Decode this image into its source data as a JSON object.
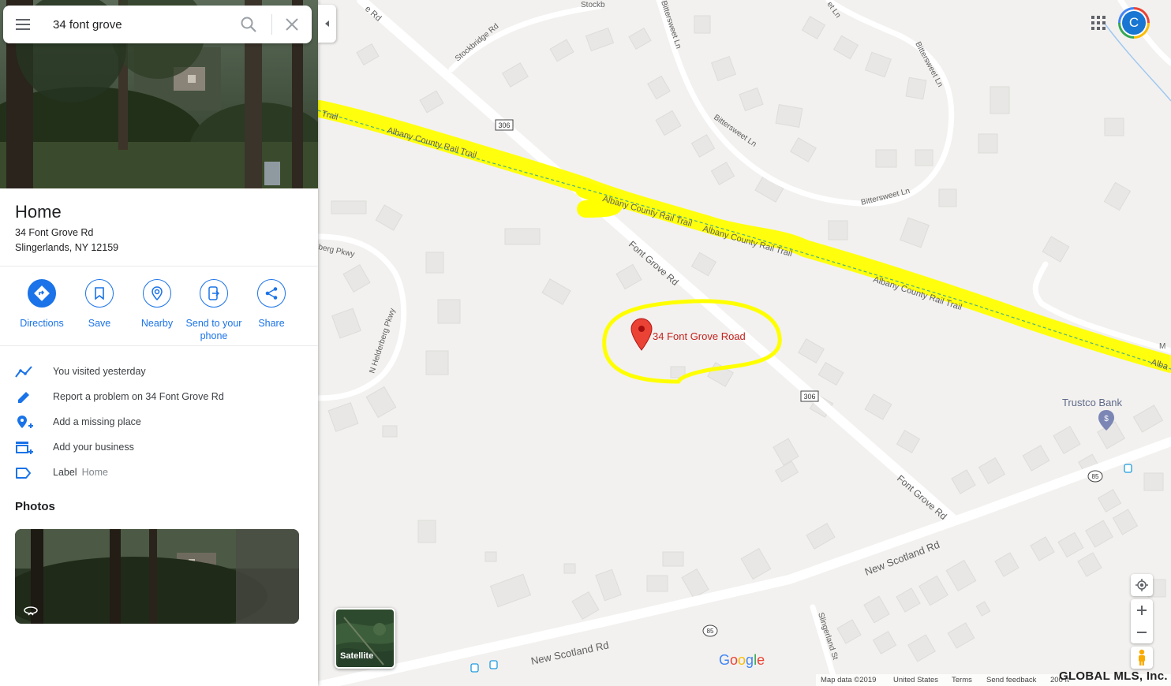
{
  "search": {
    "query": "34 font grove"
  },
  "place": {
    "title": "Home",
    "address_line1": "34 Font Grove Rd",
    "address_line2": "Slingerlands, NY 12159"
  },
  "actions": [
    {
      "label": "Directions",
      "icon": "directions-icon"
    },
    {
      "label": "Save",
      "icon": "bookmark-icon"
    },
    {
      "label": "Nearby",
      "icon": "nearby-icon"
    },
    {
      "label": "Send to your phone",
      "icon": "send-to-phone-icon"
    },
    {
      "label": "Share",
      "icon": "share-icon"
    }
  ],
  "rows": [
    {
      "text": "You visited yesterday",
      "icon": "timeline-icon"
    },
    {
      "text": "Report a problem on 34 Font Grove Rd",
      "icon": "pencil-icon"
    },
    {
      "text": "Add a missing place",
      "icon": "add-place-icon"
    },
    {
      "text": "Add your business",
      "icon": "add-business-icon"
    },
    {
      "text": "Label",
      "sub": "Home",
      "icon": "label-icon"
    }
  ],
  "photos_heading": "Photos",
  "user": {
    "initial": "C"
  },
  "map": {
    "marker_label": "34 Font Grove Road",
    "highway_306": "306",
    "highway_85": "85",
    "poi_trustco": "Trustco Bank",
    "roads": {
      "albany_trail": "Albany County Rail Trail",
      "trail_short": "Trail",
      "font_grove": "Font Grove Rd",
      "new_scotland": "New Scotland Rd",
      "stockbridge": "Stockbridge Rd",
      "stockb_top": "Stockb",
      "bittersweet": "Bittersweet Ln",
      "n_helderberg": "N Helderberg Pkwy",
      "helderberg_partial": "berg Pkwy",
      "slingerland_st": "Slingerland St",
      "e_rd": "e Rd",
      "et_ln": "et Ln",
      "alba": "Alba",
      "m": "M"
    },
    "satellite_label": "Satellite",
    "google_logo": "Google",
    "brand_colors": {
      "blue": "#4285f4",
      "red": "#ea4335",
      "yellow": "#fbbc04",
      "green": "#34a853"
    },
    "highlight_color": "#ffff00"
  },
  "footer": {
    "map_data": "Map data ©2019",
    "country": "United States",
    "terms": "Terms",
    "feedback": "Send feedback",
    "scale": "200 ft"
  },
  "watermark": "GLOBAL MLS, Inc."
}
